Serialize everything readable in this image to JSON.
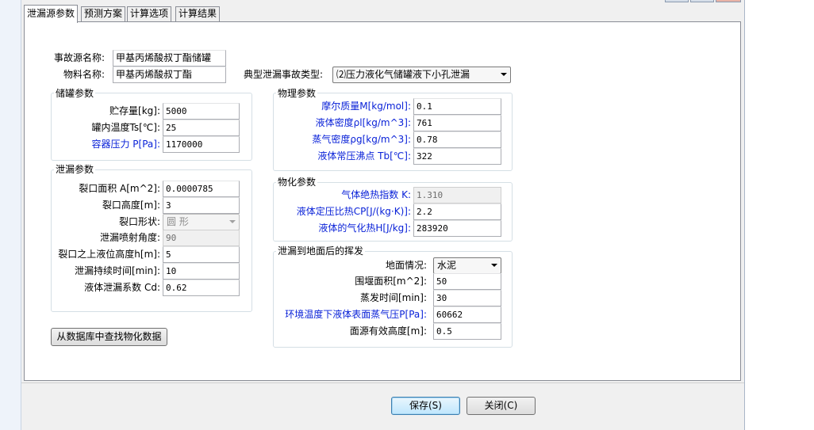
{
  "tabs": [
    "泄漏源参数",
    "预测方案",
    "计算选项",
    "计算结果"
  ],
  "top": {
    "source_name_label": "事故源名称:",
    "source_name_value": "甲基丙烯酸叔丁酯储罐",
    "material_label": "物料名称:",
    "material_value": "甲基丙烯酸叔丁酯",
    "accident_type_label": "典型泄漏事故类型:",
    "accident_type_value": "⑵压力液化气储罐液下小孔泄漏"
  },
  "tank": {
    "title": "储罐参数",
    "storage_label": "贮存量[kg]:",
    "storage_value": "5000",
    "temp_label": "罐内温度Ts[℃]:",
    "temp_value": "25",
    "pressure_label": "容器压力 P[Pa]:",
    "pressure_value": "1170000"
  },
  "leak": {
    "title": "泄漏参数",
    "area_label": "裂口面积 A[m^2]:",
    "area_value": "0.0000785",
    "height_label": "裂口高度[m]:",
    "height_value": "3",
    "shape_label": "裂口形状:",
    "shape_value": "圆  形",
    "angle_label": "泄漏喷射角度:",
    "angle_value": "90",
    "level_label": "裂口之上液位高度h[m]:",
    "level_value": "5",
    "duration_label": "泄漏持续时间[min]:",
    "duration_value": "10",
    "coef_label": "液体泄漏系数  Cd:",
    "coef_value": "0.62"
  },
  "physical": {
    "title": "物理参数",
    "molar_label": "摩尔质量M[kg/mol]:",
    "molar_value": "0.1",
    "liquid_density_label": "液体密度ρl[kg/m^3]:",
    "liquid_density_value": "761",
    "vapor_density_label": "蒸气密度ρg[kg/m^3]:",
    "vapor_density_value": "0.78",
    "boiling_label": "液体常压沸点 Tb[℃]:",
    "boiling_value": "322"
  },
  "physchem": {
    "title": "物化参数",
    "gamma_label": "气体绝热指数  K:",
    "gamma_value": "1.310",
    "cp_label": "液体定压比热CP[J/(kg·K)]:",
    "cp_value": "2.2",
    "hv_label": "液体的气化热H[J/kg]:",
    "hv_value": "283920"
  },
  "evap": {
    "title": "泄漏到地面后的挥发",
    "ground_label": "地面情况:",
    "ground_value": "水泥",
    "dike_label": "围堰面积[m^2]:",
    "dike_value": "50",
    "time_label": "蒸发时间[min]:",
    "time_value": "30",
    "vp_label": "环境温度下液体表面蒸气压P[Pa]:",
    "vp_value": "60662",
    "eff_height_label": "面源有效高度[m]:",
    "eff_height_value": "0.5"
  },
  "buttons": {
    "lookup": "从数据库中查找物化数据",
    "save": "保存(S)",
    "close": "关闭(C)"
  }
}
